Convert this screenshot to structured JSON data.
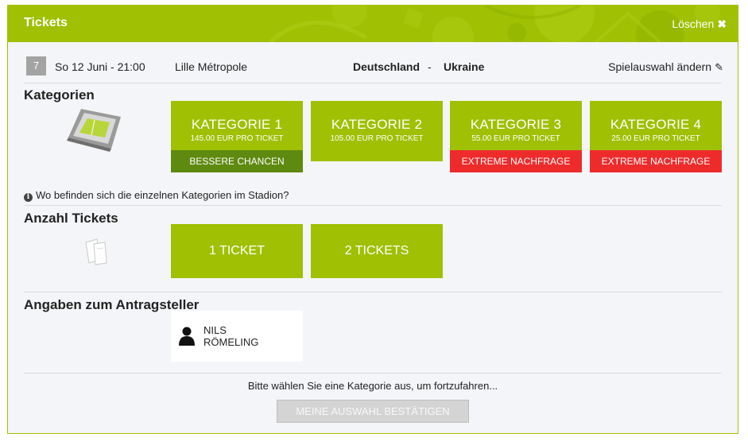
{
  "header": {
    "title": "Tickets",
    "clear_label": "Löschen",
    "clear_icon": "close-icon"
  },
  "match": {
    "day": "7",
    "date": "So 12 Juni - 21:00",
    "venue": "Lille Métropole",
    "team1": "Deutschland",
    "separator": "-",
    "team2": "Ukraine",
    "change_label": "Spielauswahl ändern",
    "change_icon": "pencil-icon"
  },
  "categories": {
    "title": "Kategorien",
    "items": [
      {
        "name": "KATEGORIE 1",
        "price": "145.00 EUR PRO TICKET",
        "badge": "BESSERE CHANCEN",
        "badge_color": "#5f8a10"
      },
      {
        "name": "KATEGORIE 2",
        "price": "105.00 EUR PRO TICKET",
        "badge": ""
      },
      {
        "name": "KATEGORIE 3",
        "price": "55.00 EUR PRO TICKET",
        "badge": "EXTREME NACHFRAGE",
        "badge_color": "#ee2b2b"
      },
      {
        "name": "KATEGORIE 4",
        "price": "25.00 EUR PRO TICKET",
        "badge": "EXTREME NACHFRAGE",
        "badge_color": "#ee2b2b"
      }
    ],
    "info_text": "Wo befinden sich die einzelnen Kategorien im Stadion?"
  },
  "tickets": {
    "title": "Anzahl Tickets",
    "options": [
      "1 TICKET",
      "2 TICKETS"
    ]
  },
  "applicant": {
    "title": "Angaben zum Antragsteller",
    "first_name": "NILS",
    "last_name": "RÖMELING"
  },
  "footer": {
    "hint": "Bitte wählen Sie eine Kategorie aus, um fortzufahren...",
    "confirm_label": "MEINE AUSWAHL BESTÄTIGEN"
  },
  "colors": {
    "accent": "#9fc003",
    "accent_dark": "#5f8a10",
    "alert": "#ee2b2b",
    "panel_bg": "#f4f5f9"
  }
}
